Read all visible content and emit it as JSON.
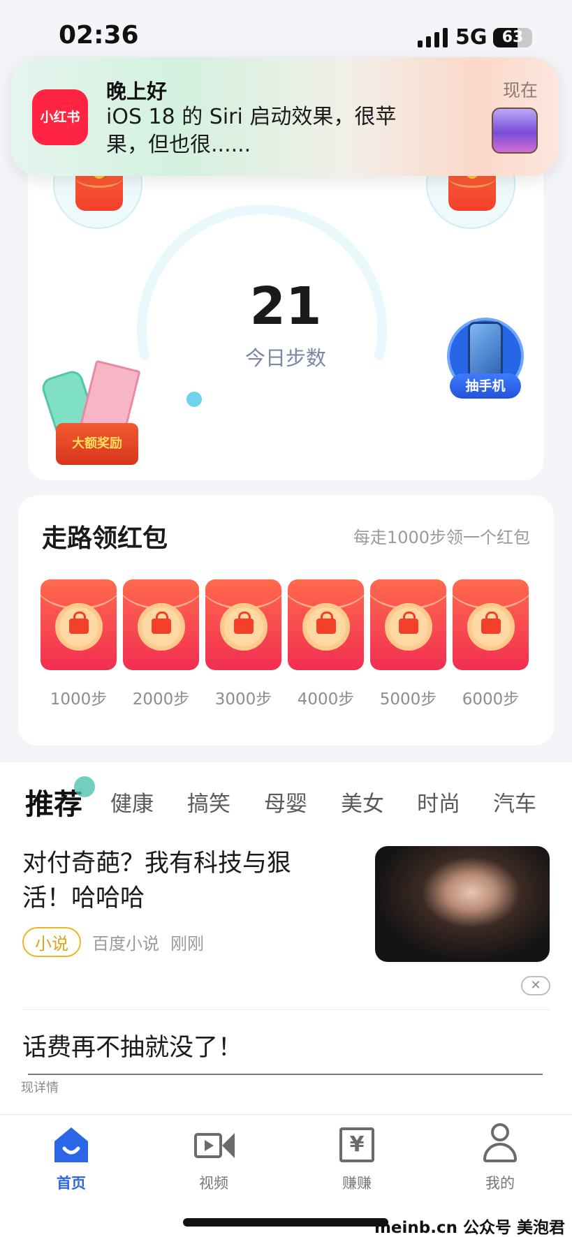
{
  "status_bar": {
    "time": "02:36",
    "network": "5G",
    "battery": "63",
    "battery_level": 0.63
  },
  "notification": {
    "app_icon_text": "小红书",
    "title": "晚上好",
    "body": "iOS 18 的 Siri 启动效果，很苹果，但也很......",
    "time": "现在"
  },
  "steps": {
    "count": "21",
    "label": "今日步数",
    "big_reward_label": "大额奖励",
    "phone_prize_label": "抽手机"
  },
  "walk_rewards": {
    "title": "走路领红包",
    "hint": "每走1000步领一个红包",
    "items": [
      {
        "label": "1000步"
      },
      {
        "label": "2000步"
      },
      {
        "label": "3000步"
      },
      {
        "label": "4000步"
      },
      {
        "label": "5000步"
      },
      {
        "label": "6000步"
      }
    ]
  },
  "feed": {
    "tabs": [
      "推荐",
      "健康",
      "搞笑",
      "母婴",
      "美女",
      "时尚",
      "汽车"
    ],
    "article": {
      "headline": "对付奇葩？我有科技与狠活！哈哈哈",
      "tag": "小说",
      "source": "百度小说",
      "time": "刚刚"
    },
    "close_symbol": "✕",
    "ad_title": "话费再不抽就没了！",
    "ad_more": "现详情"
  },
  "bottom_nav": {
    "items": [
      {
        "label": "首页",
        "icon": "home-icon",
        "active": true
      },
      {
        "label": "视频",
        "icon": "video-icon",
        "active": false
      },
      {
        "label": "赚赚",
        "icon": "yen-icon",
        "active": false
      },
      {
        "label": "我的",
        "icon": "profile-icon",
        "active": false
      }
    ]
  },
  "watermark": "meinb.cn  公众号 美泡君",
  "colors": {
    "accent": "#2a66e6",
    "red_packet": "#f2402a",
    "gauge": "#e9f8fb",
    "tag_gold": "#e8b823"
  }
}
